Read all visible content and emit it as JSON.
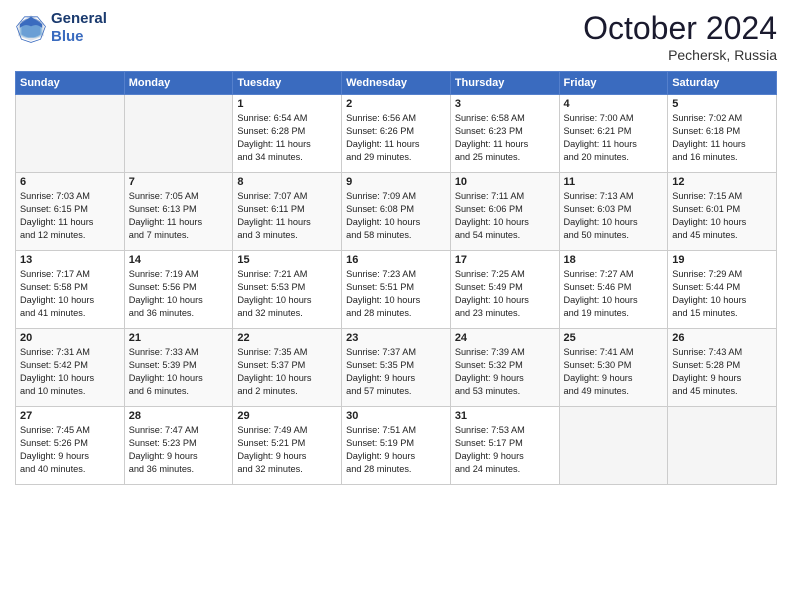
{
  "header": {
    "logo_line1": "General",
    "logo_line2": "Blue",
    "month": "October 2024",
    "location": "Pechersk, Russia"
  },
  "days_of_week": [
    "Sunday",
    "Monday",
    "Tuesday",
    "Wednesday",
    "Thursday",
    "Friday",
    "Saturday"
  ],
  "weeks": [
    [
      {
        "num": "",
        "info": ""
      },
      {
        "num": "",
        "info": ""
      },
      {
        "num": "1",
        "info": "Sunrise: 6:54 AM\nSunset: 6:28 PM\nDaylight: 11 hours\nand 34 minutes."
      },
      {
        "num": "2",
        "info": "Sunrise: 6:56 AM\nSunset: 6:26 PM\nDaylight: 11 hours\nand 29 minutes."
      },
      {
        "num": "3",
        "info": "Sunrise: 6:58 AM\nSunset: 6:23 PM\nDaylight: 11 hours\nand 25 minutes."
      },
      {
        "num": "4",
        "info": "Sunrise: 7:00 AM\nSunset: 6:21 PM\nDaylight: 11 hours\nand 20 minutes."
      },
      {
        "num": "5",
        "info": "Sunrise: 7:02 AM\nSunset: 6:18 PM\nDaylight: 11 hours\nand 16 minutes."
      }
    ],
    [
      {
        "num": "6",
        "info": "Sunrise: 7:03 AM\nSunset: 6:15 PM\nDaylight: 11 hours\nand 12 minutes."
      },
      {
        "num": "7",
        "info": "Sunrise: 7:05 AM\nSunset: 6:13 PM\nDaylight: 11 hours\nand 7 minutes."
      },
      {
        "num": "8",
        "info": "Sunrise: 7:07 AM\nSunset: 6:11 PM\nDaylight: 11 hours\nand 3 minutes."
      },
      {
        "num": "9",
        "info": "Sunrise: 7:09 AM\nSunset: 6:08 PM\nDaylight: 10 hours\nand 58 minutes."
      },
      {
        "num": "10",
        "info": "Sunrise: 7:11 AM\nSunset: 6:06 PM\nDaylight: 10 hours\nand 54 minutes."
      },
      {
        "num": "11",
        "info": "Sunrise: 7:13 AM\nSunset: 6:03 PM\nDaylight: 10 hours\nand 50 minutes."
      },
      {
        "num": "12",
        "info": "Sunrise: 7:15 AM\nSunset: 6:01 PM\nDaylight: 10 hours\nand 45 minutes."
      }
    ],
    [
      {
        "num": "13",
        "info": "Sunrise: 7:17 AM\nSunset: 5:58 PM\nDaylight: 10 hours\nand 41 minutes."
      },
      {
        "num": "14",
        "info": "Sunrise: 7:19 AM\nSunset: 5:56 PM\nDaylight: 10 hours\nand 36 minutes."
      },
      {
        "num": "15",
        "info": "Sunrise: 7:21 AM\nSunset: 5:53 PM\nDaylight: 10 hours\nand 32 minutes."
      },
      {
        "num": "16",
        "info": "Sunrise: 7:23 AM\nSunset: 5:51 PM\nDaylight: 10 hours\nand 28 minutes."
      },
      {
        "num": "17",
        "info": "Sunrise: 7:25 AM\nSunset: 5:49 PM\nDaylight: 10 hours\nand 23 minutes."
      },
      {
        "num": "18",
        "info": "Sunrise: 7:27 AM\nSunset: 5:46 PM\nDaylight: 10 hours\nand 19 minutes."
      },
      {
        "num": "19",
        "info": "Sunrise: 7:29 AM\nSunset: 5:44 PM\nDaylight: 10 hours\nand 15 minutes."
      }
    ],
    [
      {
        "num": "20",
        "info": "Sunrise: 7:31 AM\nSunset: 5:42 PM\nDaylight: 10 hours\nand 10 minutes."
      },
      {
        "num": "21",
        "info": "Sunrise: 7:33 AM\nSunset: 5:39 PM\nDaylight: 10 hours\nand 6 minutes."
      },
      {
        "num": "22",
        "info": "Sunrise: 7:35 AM\nSunset: 5:37 PM\nDaylight: 10 hours\nand 2 minutes."
      },
      {
        "num": "23",
        "info": "Sunrise: 7:37 AM\nSunset: 5:35 PM\nDaylight: 9 hours\nand 57 minutes."
      },
      {
        "num": "24",
        "info": "Sunrise: 7:39 AM\nSunset: 5:32 PM\nDaylight: 9 hours\nand 53 minutes."
      },
      {
        "num": "25",
        "info": "Sunrise: 7:41 AM\nSunset: 5:30 PM\nDaylight: 9 hours\nand 49 minutes."
      },
      {
        "num": "26",
        "info": "Sunrise: 7:43 AM\nSunset: 5:28 PM\nDaylight: 9 hours\nand 45 minutes."
      }
    ],
    [
      {
        "num": "27",
        "info": "Sunrise: 7:45 AM\nSunset: 5:26 PM\nDaylight: 9 hours\nand 40 minutes."
      },
      {
        "num": "28",
        "info": "Sunrise: 7:47 AM\nSunset: 5:23 PM\nDaylight: 9 hours\nand 36 minutes."
      },
      {
        "num": "29",
        "info": "Sunrise: 7:49 AM\nSunset: 5:21 PM\nDaylight: 9 hours\nand 32 minutes."
      },
      {
        "num": "30",
        "info": "Sunrise: 7:51 AM\nSunset: 5:19 PM\nDaylight: 9 hours\nand 28 minutes."
      },
      {
        "num": "31",
        "info": "Sunrise: 7:53 AM\nSunset: 5:17 PM\nDaylight: 9 hours\nand 24 minutes."
      },
      {
        "num": "",
        "info": ""
      },
      {
        "num": "",
        "info": ""
      }
    ]
  ]
}
